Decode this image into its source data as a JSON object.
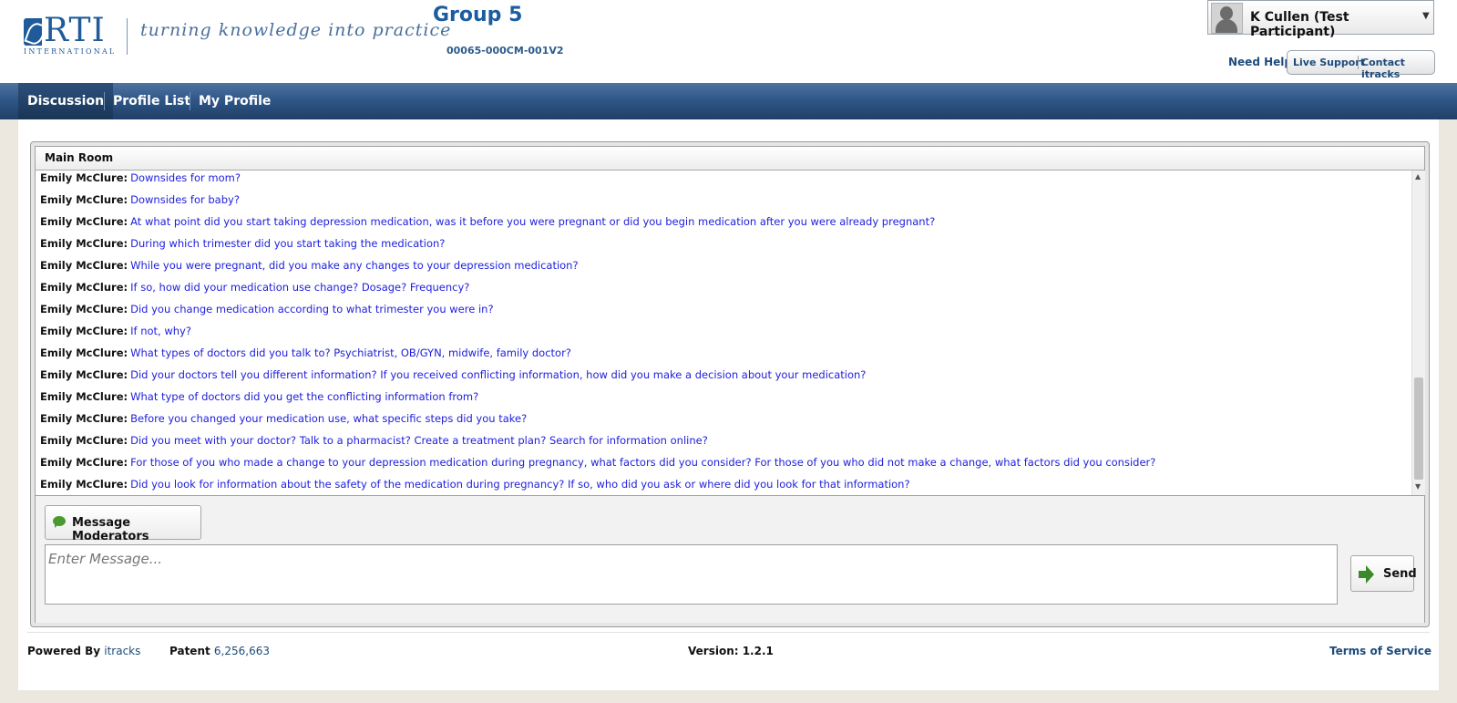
{
  "header": {
    "logo_text": "RTI",
    "logo_subtext": "INTERNATIONAL",
    "tagline": "turning knowledge into practice",
    "group_title": "Group 5",
    "group_code": "00065-000CM-001V2"
  },
  "user": {
    "name": "K Cullen (Test Participant)"
  },
  "help": {
    "label": "Need Help?",
    "live_support": "Live Support",
    "contact": "Contact itracks"
  },
  "nav": {
    "items": [
      "Discussion",
      "Profile List",
      "My Profile"
    ],
    "active": "Discussion"
  },
  "room": {
    "title": "Main Room",
    "messages": [
      {
        "author": "Emily McClure:",
        "text": "Downsides for mom?"
      },
      {
        "author": "Emily McClure:",
        "text": "Downsides for baby?"
      },
      {
        "author": "Emily McClure:",
        "text": "At what point did you start taking depression medication, was it before you were pregnant or did you begin medication after you were already pregnant?"
      },
      {
        "author": "Emily McClure:",
        "text": "During which trimester did you start taking the medication?"
      },
      {
        "author": "Emily McClure:",
        "text": "While you were pregnant, did you make any changes to your depression medication?"
      },
      {
        "author": "Emily McClure:",
        "text": "If so, how did your medication use change? Dosage? Frequency?"
      },
      {
        "author": "Emily McClure:",
        "text": "Did you change medication according to what trimester you were in?"
      },
      {
        "author": "Emily McClure:",
        "text": "If not, why?"
      },
      {
        "author": "Emily McClure:",
        "text": "What types of doctors did you talk to? Psychiatrist, OB/GYN, midwife, family doctor?"
      },
      {
        "author": "Emily McClure:",
        "text": "Did your doctors tell you different information? If you received conflicting information, how did you make a decision about your medication?"
      },
      {
        "author": "Emily McClure:",
        "text": "What type of doctors did you get the conflicting information from?"
      },
      {
        "author": "Emily McClure:",
        "text": "Before you changed your medication use, what specific steps did you take?"
      },
      {
        "author": "Emily McClure:",
        "text": "Did you meet with your doctor? Talk to a pharmacist? Create a treatment plan? Search for information online?"
      },
      {
        "author": "Emily McClure:",
        "text": "For those of you who made a change to your depression medication during pregnancy, what factors did you consider? For those of you who did not make a change, what factors did you consider?"
      },
      {
        "author": "Emily McClure:",
        "text": "Did you look for information about the safety of the medication during pregnancy? If so, who did you ask or where did you look for that information?"
      }
    ]
  },
  "compose": {
    "moderators_button": "Message Moderators",
    "placeholder": "Enter Message...",
    "send_button": "Send"
  },
  "footer": {
    "powered_by": "Powered By",
    "powered_link": "itracks",
    "patent_label": "Patent",
    "patent_number": "6,256,663",
    "version": "Version: 1.2.1",
    "terms": "Terms of Service"
  },
  "colors": {
    "brand_blue": "#1c5da0",
    "message_text": "#2020dd",
    "nav_bg": "#2f5788"
  }
}
